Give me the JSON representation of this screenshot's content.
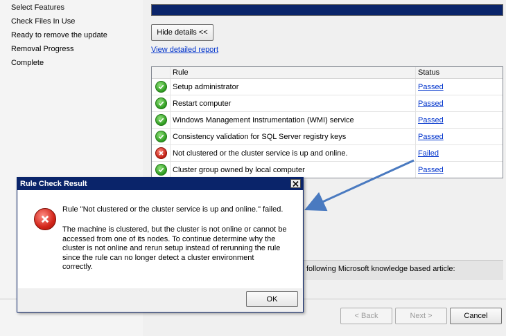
{
  "nav": {
    "items": [
      "Select Features",
      "Check Files In Use",
      "Ready to remove the update",
      "Removal Progress",
      "Complete"
    ]
  },
  "details": {
    "hide_button": "Hide details <<",
    "report_link": "View detailed report"
  },
  "table": {
    "columns": [
      "Rule",
      "Status"
    ],
    "rows": [
      {
        "icon": "check-circle-icon",
        "rule": "Setup administrator",
        "status": "Passed"
      },
      {
        "icon": "check-circle-icon",
        "rule": "Restart computer",
        "status": "Passed"
      },
      {
        "icon": "check-circle-icon",
        "rule": "Windows Management Instrumentation (WMI) service",
        "status": "Passed"
      },
      {
        "icon": "check-circle-icon",
        "rule": "Consistency validation for SQL Server registry keys",
        "status": "Passed"
      },
      {
        "icon": "error-circle-icon",
        "rule": "Not clustered or the cluster service is up and online.",
        "status": "Failed"
      },
      {
        "icon": "check-circle-icon",
        "rule": "Cluster group owned by local computer",
        "status": "Passed"
      }
    ]
  },
  "info": {
    "text": "following Microsoft knowledge based article:"
  },
  "dialog": {
    "title": "Rule Check Result",
    "line1": "Rule \"Not clustered or the cluster service is up and online.\" failed.",
    "para_lines": [
      "The machine is clustered, but the cluster is not online or cannot be",
      "accessed from one of its nodes. To continue determine why the",
      "cluster is not online and rerun setup instead of rerunning the rule",
      "since the rule can no longer detect a cluster environment",
      "correctly."
    ],
    "ok_label": "OK"
  },
  "footer": {
    "back_label": "< Back",
    "next_label": "Next >",
    "cancel_label": "Cancel"
  },
  "colors": {
    "title_bar": "#0a246a",
    "link": "#0033cc",
    "arrow": "#4a7ac0"
  }
}
